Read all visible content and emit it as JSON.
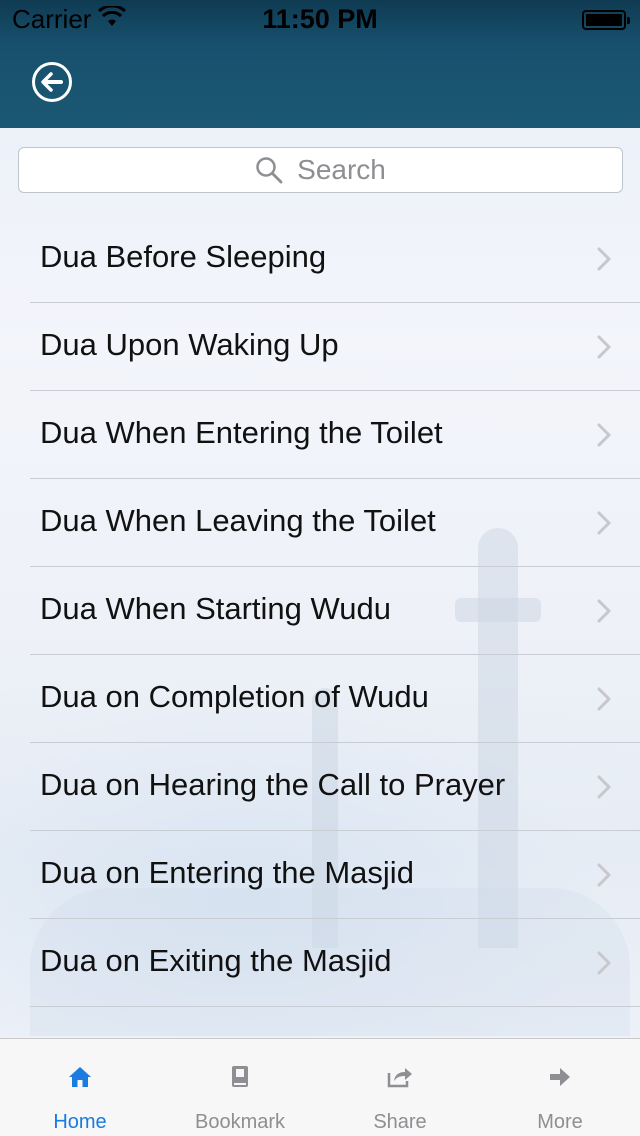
{
  "status_bar": {
    "carrier": "Carrier",
    "time": "11:50 PM"
  },
  "header": {
    "back_icon": "back-arrow-circle-icon"
  },
  "search": {
    "placeholder": "Search"
  },
  "list": {
    "items": [
      {
        "label": "Dua Before Sleeping"
      },
      {
        "label": "Dua Upon Waking Up"
      },
      {
        "label": "Dua When Entering the Toilet"
      },
      {
        "label": "Dua When Leaving the Toilet"
      },
      {
        "label": "Dua When Starting Wudu"
      },
      {
        "label": "Dua on Completion of Wudu"
      },
      {
        "label": "Dua on Hearing the Call to Prayer"
      },
      {
        "label": "Dua on Entering the Masjid"
      },
      {
        "label": "Dua on Exiting the Masjid"
      }
    ]
  },
  "tabbar": {
    "tabs": [
      {
        "label": "Home",
        "icon": "home-icon",
        "active": true
      },
      {
        "label": "Bookmark",
        "icon": "book-icon",
        "active": false
      },
      {
        "label": "Share",
        "icon": "share-icon",
        "active": false
      },
      {
        "label": "More",
        "icon": "arrow-right-icon",
        "active": false
      }
    ]
  },
  "colors": {
    "header": "#17506d",
    "active_tab": "#1a7be0",
    "inactive_tab": "#8e8e93"
  }
}
